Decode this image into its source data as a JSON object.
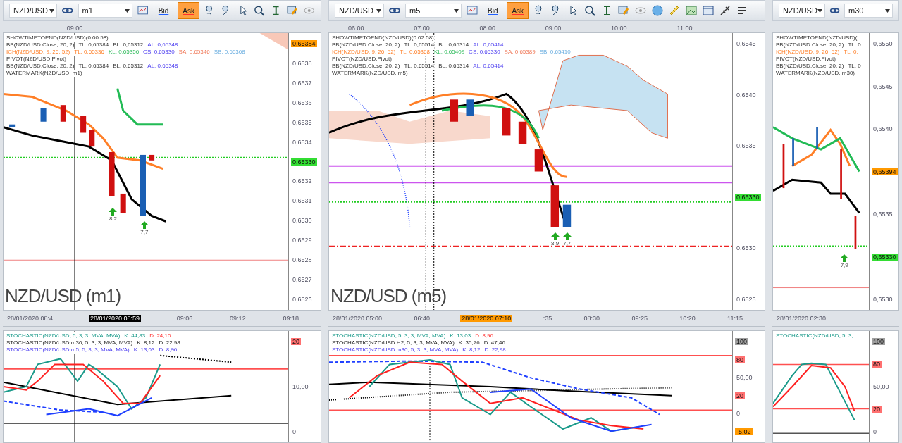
{
  "panels": [
    {
      "toolbar": {
        "symbol": "NZD/USD",
        "timeframe": "m1",
        "bid": {
          "label": "Bid",
          "selected": false
        },
        "ask": {
          "label": "Ask",
          "selected": true
        },
        "more_tools": false
      },
      "top_times": [
        "09:00"
      ],
      "legend": [
        {
          "parts": [
            {
              "text": "SHOWTIMETOEND(NZD/USD)(0:00:58)",
              "kind": "label"
            }
          ]
        },
        {
          "parts": [
            {
              "text": "BB(NZD/USD.Close, 20, 2)",
              "kind": "label"
            },
            {
              "text": "TL: 0,65384",
              "kind": "label"
            },
            {
              "text": "BL: 0,65312",
              "kind": "label"
            },
            {
              "text": "AL: 0,65348",
              "kind": "average"
            }
          ]
        },
        {
          "parts": [
            {
              "text": "ICH(NZD/USD, 9, 26, 52)",
              "kind": "tenkan"
            },
            {
              "text": "TL: 0,65336",
              "kind": "tenkan"
            },
            {
              "text": "KL: 0,65356",
              "kind": "kijun"
            },
            {
              "text": "CS: 0,65330",
              "kind": "span"
            },
            {
              "text": "SA: 0,65346",
              "kind": "senkou-a"
            },
            {
              "text": "SB: 0,65368",
              "kind": "senkou-b"
            }
          ]
        },
        {
          "parts": [
            {
              "text": "PIVOT(NZD/USD,Pivot)",
              "kind": "label"
            }
          ]
        },
        {
          "parts": [
            {
              "text": "BB(NZD/USD.Close, 20, 2)",
              "kind": "label"
            },
            {
              "text": "TL: 0,65384",
              "kind": "label"
            },
            {
              "text": "BL: 0,65312",
              "kind": "label"
            },
            {
              "text": "AL: 0,65348",
              "kind": "average"
            }
          ]
        },
        {
          "parts": [
            {
              "text": "WATERMARK(NZD/USD, m1)",
              "kind": "label"
            }
          ]
        }
      ],
      "price_axis": [
        {
          "text": "0,65384",
          "color": "#ff9900"
        },
        {
          "text": "0,6538"
        },
        {
          "text": "0,6537"
        },
        {
          "text": "0,6536"
        },
        {
          "text": "0,6535"
        },
        {
          "text": "0,6534"
        },
        {
          "text": "0,65330",
          "color": "#33dd33"
        },
        {
          "text": "0,6532"
        },
        {
          "text": "0,6531"
        },
        {
          "text": "0,6530"
        },
        {
          "text": "0,6529"
        },
        {
          "text": "0,6528"
        },
        {
          "text": "0,6527"
        },
        {
          "text": "0,6526"
        }
      ],
      "markers": [
        "8,2",
        "7,7"
      ],
      "watermark": "NZD/USD (m1)",
      "dates": [
        {
          "text": "28/01/2020 08:4"
        },
        {
          "text": "28/01/2020 08:59",
          "color": "#000000"
        },
        {
          "text": "09:06"
        },
        {
          "text": "09:12"
        },
        {
          "text": "09:18"
        }
      ],
      "stoch_legend": [
        {
          "parts": [
            {
              "text": "STOCHASTIC(NZD/USD, 5, 3, 3, MVA, MVA)",
              "kind": "k-line"
            },
            {
              "text": "K: 44,83",
              "kind": "k-line"
            },
            {
              "text": "D: 24,10",
              "kind": "d-line"
            }
          ]
        },
        {
          "parts": [
            {
              "text": "STOCHASTIC(NZD/USD.m30, 5, 3, 3, MVA, MVA)",
              "kind": "secondary"
            },
            {
              "text": "K: 8,12",
              "kind": "secondary"
            },
            {
              "text": "D: 22,98",
              "kind": "secondary"
            }
          ]
        },
        {
          "parts": [
            {
              "text": "STOCHASTIC(NZD/USD.m5, 5, 3, 3, MVA, MVA)",
              "kind": "tertiary"
            },
            {
              "text": "K: 13,03",
              "kind": "tertiary"
            },
            {
              "text": "D: 8,96",
              "kind": "tertiary"
            }
          ]
        }
      ],
      "stoch_axis": [
        {
          "text": "20",
          "color": "#ff7070"
        },
        {
          "text": "10,00"
        },
        {
          "text": "0"
        }
      ]
    },
    {
      "toolbar": {
        "symbol": "NZD/USD",
        "timeframe": "m5",
        "bid": {
          "label": "Bid",
          "selected": false
        },
        "ask": {
          "label": "Ask",
          "selected": true
        },
        "more_tools": true
      },
      "legend": [
        {
          "parts": [
            {
              "text": "SHOWTIMETOEND(NZD/USD)(0:02:58)",
              "kind": "label"
            }
          ]
        },
        {
          "parts": [
            {
              "text": "BB(NZD/USD.Close, 20, 2)",
              "kind": "label"
            },
            {
              "text": "TL: 0,65514",
              "kind": "label"
            },
            {
              "text": "BL: 0,65314",
              "kind": "label"
            },
            {
              "text": "AL: 0,65414",
              "kind": "average"
            }
          ]
        },
        {
          "parts": [
            {
              "text": "ICH(NZD/USD, 9, 26, 52)",
              "kind": "tenkan"
            },
            {
              "text": "TL: 0,65368",
              "kind": "tenkan"
            },
            {
              "text": "KL: 0,65409",
              "kind": "kijun"
            },
            {
              "text": "CS: 0,65330",
              "kind": "span"
            },
            {
              "text": "SA: 0,65389",
              "kind": "senkou-a"
            },
            {
              "text": "SB: 0,65410",
              "kind": "senkou-b"
            }
          ]
        },
        {
          "parts": [
            {
              "text": "PIVOT(NZD/USD,Pivot)",
              "kind": "label"
            }
          ]
        },
        {
          "parts": [
            {
              "text": "BB(NZD/USD.Close, 20, 2)",
              "kind": "label"
            },
            {
              "text": "TL: 0,65514",
              "kind": "label"
            },
            {
              "text": "BL: 0,65314",
              "kind": "label"
            },
            {
              "text": "AL: 0,65414",
              "kind": "average"
            }
          ]
        },
        {
          "parts": [
            {
              "text": "WATERMARK(NZD/USD, m5)",
              "kind": "label"
            }
          ]
        }
      ],
      "price_axis": [
        {
          "text": "0,6545"
        },
        {
          "text": "0,6540"
        },
        {
          "text": "0,6535"
        },
        {
          "text": "0,65330",
          "color": "#33dd33"
        },
        {
          "text": "0,6530"
        },
        {
          "text": "0,6525"
        }
      ],
      "top_times": [
        "06:00",
        "07:00",
        "08:00",
        "09:00",
        "10:00",
        "11:00"
      ],
      "markers": [
        "8,9",
        "7,7"
      ],
      "watermark": "NZD/USD (m5)",
      "dates": [
        {
          "text": "28/01/2020 05:00"
        },
        {
          "text": "06:40"
        },
        {
          "text": "28/01/2020 07:10",
          "color": "#ff9900"
        },
        {
          "text": ":35"
        },
        {
          "text": "08:30"
        },
        {
          "text": "09:25"
        },
        {
          "text": "10:20"
        },
        {
          "text": "11:15"
        }
      ],
      "stoch_legend": [
        {
          "parts": [
            {
              "text": "STOCHASTIC(NZD/USD, 5, 3, 3, MVA, MVA)",
              "kind": "k-line"
            },
            {
              "text": "K: 13,03",
              "kind": "k-line"
            },
            {
              "text": "D: 8,96",
              "kind": "d-line"
            }
          ]
        },
        {
          "parts": [
            {
              "text": "STOCHASTIC(NZD/USD.H2, 5, 3, 3, MVA, MVA)",
              "kind": "secondary"
            },
            {
              "text": "K: 35,76",
              "kind": "secondary"
            },
            {
              "text": "D: 47,46",
              "kind": "secondary"
            }
          ]
        },
        {
          "parts": [
            {
              "text": "STOCHASTIC(NZD/USD.m30, 5, 3, 3, MVA, MVA)",
              "kind": "tertiary"
            },
            {
              "text": "K: 8,12",
              "kind": "tertiary"
            },
            {
              "text": "D: 22,98",
              "kind": "tertiary"
            }
          ]
        }
      ],
      "stoch_axis": [
        {
          "text": "100",
          "color": "#a0a0a0"
        },
        {
          "text": "80",
          "color": "#ff7070"
        },
        {
          "text": "50,00"
        },
        {
          "text": "20",
          "color": "#ff7070"
        },
        {
          "text": "0"
        },
        {
          "text": "-5,02",
          "color": "#ff9900"
        }
      ]
    },
    {
      "toolbar": {
        "symbol": "NZD/USD",
        "timeframe": "m30",
        "more_tools": false
      },
      "legend": [
        {
          "parts": [
            {
              "text": "SHOWTIMETOEND(NZD/USD)(...",
              "kind": "label"
            }
          ]
        },
        {
          "parts": [
            {
              "text": "BB(NZD/USD.Close, 20, 2)",
              "kind": "label"
            },
            {
              "text": "TL: 0",
              "kind": "label"
            }
          ]
        },
        {
          "parts": [
            {
              "text": "ICH(NZD/USD, 9, 26, 52)",
              "kind": "tenkan"
            },
            {
              "text": "TL: 0,",
              "kind": "tenkan"
            }
          ]
        },
        {
          "parts": [
            {
              "text": "PIVOT(NZD/USD,Pivot)",
              "kind": "label"
            }
          ]
        },
        {
          "parts": [
            {
              "text": "BB(NZD/USD.Close, 20, 2)",
              "kind": "label"
            },
            {
              "text": "TL: 0",
              "kind": "label"
            }
          ]
        },
        {
          "parts": [
            {
              "text": "WATERMARK(NZD/USD, m30)",
              "kind": "label"
            }
          ]
        }
      ],
      "price_axis": [
        {
          "text": "0,6550"
        },
        {
          "text": "0,6545"
        },
        {
          "text": "0,6540"
        },
        {
          "text": "0,65394",
          "color": "#ff9900"
        },
        {
          "text": "0,6535"
        },
        {
          "text": "0,65330",
          "color": "#33dd33"
        },
        {
          "text": "0,6530"
        }
      ],
      "markers": [
        "7,9"
      ],
      "dates": [
        {
          "text": "28/01/2020 02:30"
        }
      ],
      "stoch_legend": [
        {
          "parts": [
            {
              "text": "STOCHASTIC(NZD/USD, 5, 3, ...",
              "kind": "k-line"
            }
          ]
        }
      ],
      "stoch_axis": [
        {
          "text": "100",
          "color": "#a0a0a0"
        },
        {
          "text": "80",
          "color": "#ff7070"
        },
        {
          "text": "50,00"
        },
        {
          "text": "20",
          "color": "#ff7070"
        },
        {
          "text": "0"
        }
      ]
    }
  ]
}
